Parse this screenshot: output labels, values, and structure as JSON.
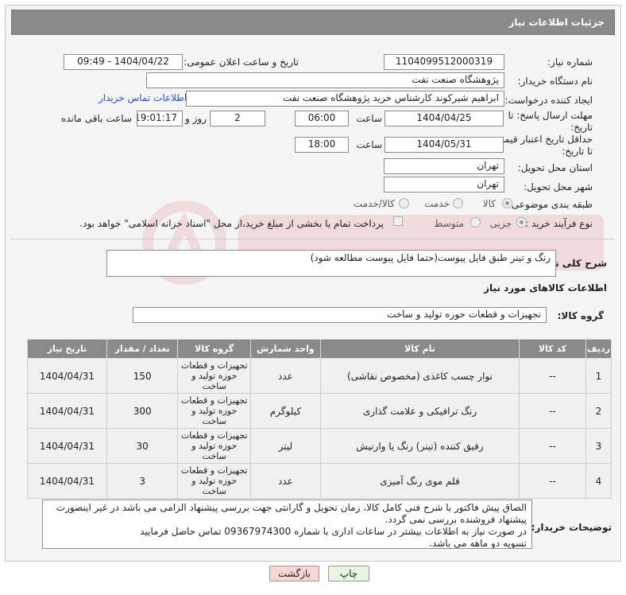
{
  "header": {
    "title": "جزئیات اطلاعات نیاز"
  },
  "form": {
    "need_number_label": "شماره نیاز:",
    "need_number": "1104099512000319",
    "announce_label": "تاریخ و ساعت اعلان عمومی:",
    "announce_value": "1404/04/22 - 09:49",
    "buyer_org_label": "نام دستگاه خریدار:",
    "buyer_org": "پژوهشگاه صنعت نفت",
    "creator_label": "ایجاد کننده درخواست:",
    "creator": "ابراهیم شیرکوند کارشناس خرید پژوهشگاه صنعت نفت",
    "contact_link": "اطلاعات تماس خریدار",
    "deadline_label_1": "مهلت ارسال پاسخ: تا",
    "deadline_label_2": "تاریخ:",
    "deadline_date": "1404/04/25",
    "time_label": "ساعت",
    "deadline_time": "06:00",
    "days_value": "2",
    "days_label": "روز و",
    "remaining_time": "19:01:17",
    "remaining_label": "ساعت باقی مانده",
    "price_label_1": "حداقل تاریخ اعتبار قیمت:",
    "price_label_2": "تا تاریخ:",
    "price_date": "1404/05/31",
    "price_time": "18:00",
    "province_label": "استان محل تحویل:",
    "province": "تهران",
    "city_label": "شهر محل تحویل:",
    "city": "تهران",
    "category_label": "طبقه بندی موضوعی:",
    "category_options": [
      "کالا",
      "خدمت",
      "کالا/خدمت"
    ],
    "process_label": "نوع فرآیند خرید :",
    "process_options": [
      "جزیی",
      "متوسط"
    ],
    "payment_note": "پرداخت تمام یا بخشی از مبلغ خرید،از محل \"اسناد خزانه اسلامی\" خواهد بود."
  },
  "description": {
    "label": "شرح کلی نیاز:",
    "value": "رنگ و تینر طبق فایل پیوست(حتما فایل پیوست مطالعه شود)"
  },
  "goods": {
    "section_title": "اطلاعات کالاهای مورد نیاز",
    "group_label": "گروه کالا:",
    "group_value": "تجهیزات و قطعات حوزه تولید و ساخت"
  },
  "table": {
    "headers": [
      "ردیف",
      "کد کالا",
      "نام کالا",
      "واحد شمارش",
      "گروه کالا",
      "تعداد / مقدار",
      "تاریخ نیاز"
    ],
    "rows": [
      {
        "index": "1",
        "code": "--",
        "name": "نوار چسب کاغذی (مخصوص نقاشی)",
        "unit": "عدد",
        "group_l1": "تجهیزات و قطعات",
        "group_l2": "حوزه تولید و",
        "group_l3": "ساخت",
        "qty": "150",
        "date": "1404/04/31"
      },
      {
        "index": "2",
        "code": "--",
        "name": "رنگ ترافیکی و علامت گذاری",
        "unit": "کیلوگرم",
        "group_l1": "تجهیزات و قطعات",
        "group_l2": "حوزه تولید و",
        "group_l3": "ساخت",
        "qty": "300",
        "date": "1404/04/31"
      },
      {
        "index": "3",
        "code": "--",
        "name": "رقیق کننده (تینر) رنگ یا وارنیش",
        "unit": "لیتر",
        "group_l1": "تجهیزات و قطعات",
        "group_l2": "حوزه تولید و",
        "group_l3": "ساخت",
        "qty": "30",
        "date": "1404/04/31"
      },
      {
        "index": "4",
        "code": "--",
        "name": "قلم موی رنگ آمیزی",
        "unit": "عدد",
        "group_l1": "تجهیزات و قطعات",
        "group_l2": "حوزه تولید و",
        "group_l3": "ساخت",
        "qty": "3",
        "date": "1404/04/31"
      }
    ]
  },
  "buyer_notes": {
    "label": "توضیحات خریدار:",
    "line1": "الصاق پیش فاکتور با شرح فنی کامل کالا، زمان تحویل و گارانتی جهت بررسی پیشنهاد الزامی می باشد در غیر اینصورت",
    "line2": "پیشنهاد فروشنده بررسی نمی گردد.",
    "line3": "در صورت نیاز به اطلاعات بیشتر در ساعات اداری با شماره 09367974300 تماس حاصل فرمایید",
    "line4": "تسویه دو ماهه می باشد."
  },
  "buttons": {
    "print": "چاپ",
    "back": "بازگشت"
  },
  "colors": {
    "header": "#8a8a8a",
    "link": "#1a56c4",
    "back_button": "#f7d6d6",
    "print_button": "#e8f5e0"
  }
}
